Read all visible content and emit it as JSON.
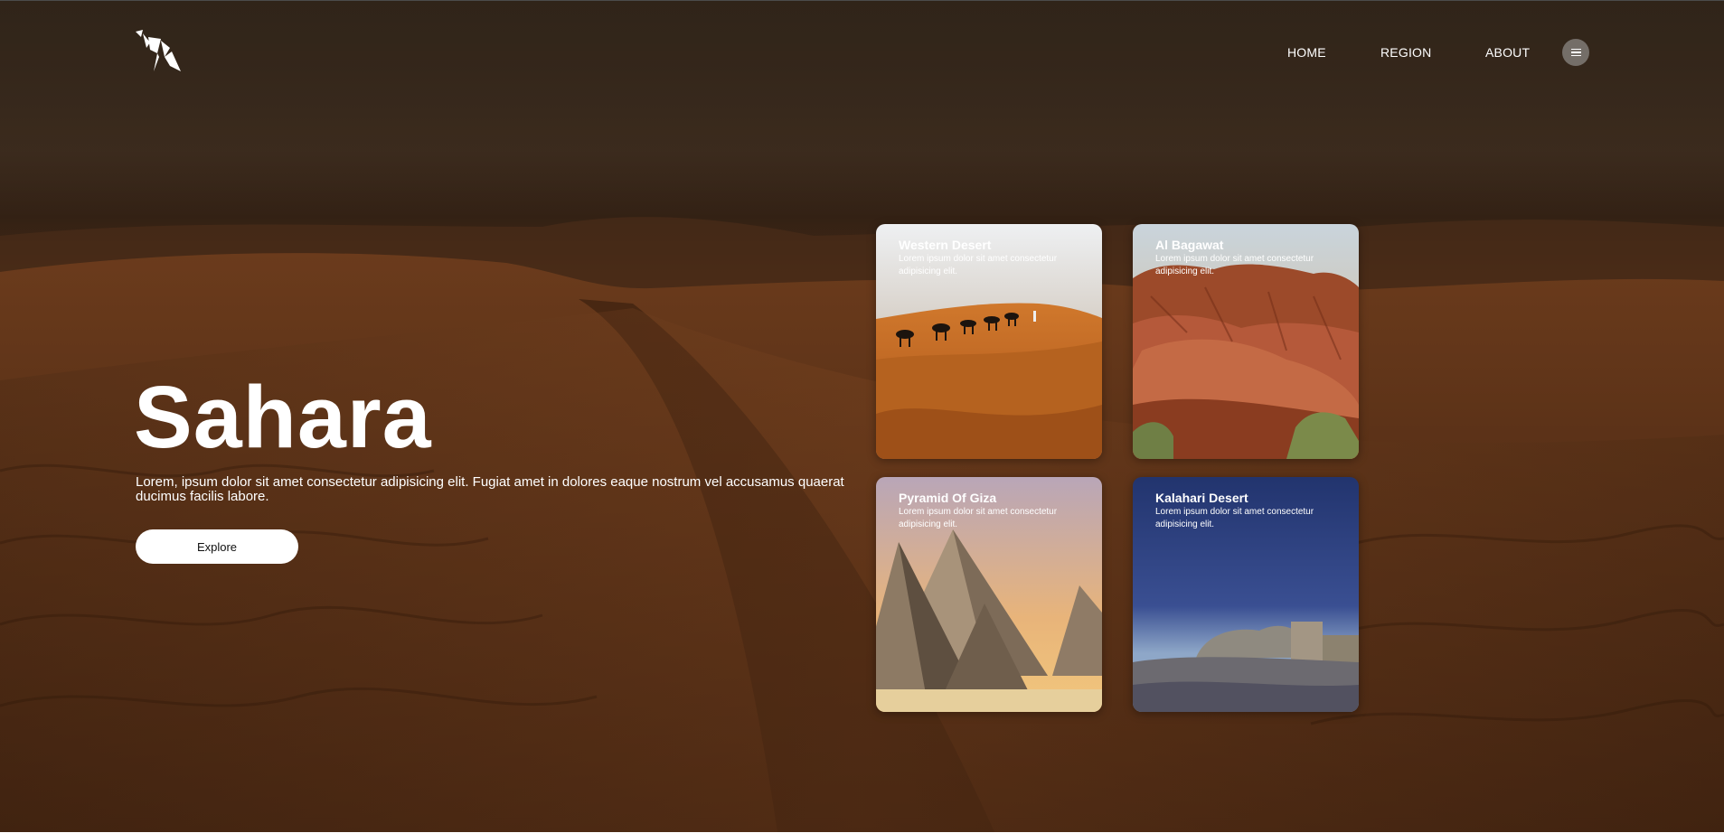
{
  "brand": {
    "logo_icon": "camel-origami-icon"
  },
  "nav": {
    "links": [
      {
        "label": "HOME"
      },
      {
        "label": "REGION"
      },
      {
        "label": "ABOUT"
      }
    ],
    "menu_icon": "hamburger-menu-icon"
  },
  "hero": {
    "title": "Sahara",
    "description": "Lorem, ipsum dolor sit amet consectetur adipisicing elit. Fugiat amet in dolores eaque nostrum vel accusamus quaerat ducimus facilis labore.",
    "cta_label": "Explore"
  },
  "cards": [
    {
      "title": "Western Desert",
      "text": "Lorem ipsum dolor sit amet consectetur adipisicing elit."
    },
    {
      "title": "Al Bagawat",
      "text": "Lorem ipsum dolor sit amet consectetur adipisicing elit."
    },
    {
      "title": "Pyramid Of Giza",
      "text": "Lorem ipsum dolor sit amet consectetur adipisicing elit."
    },
    {
      "title": "Kalahari Desert",
      "text": "Lorem ipsum dolor sit amet consectetur adipisicing elit."
    }
  ],
  "colors": {
    "sand": "#7a421c",
    "sky": "#3c2f24",
    "text": "#ffffff",
    "button_bg": "#ffffff"
  }
}
